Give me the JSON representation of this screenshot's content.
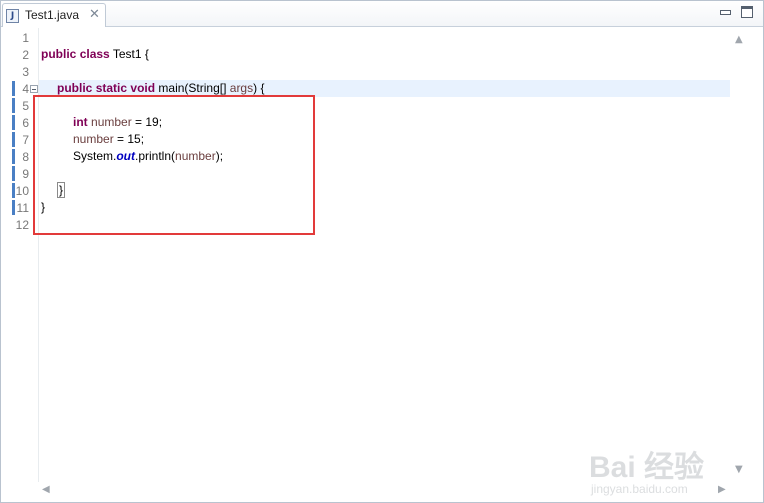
{
  "tab": {
    "label": "Test1.java",
    "icon": "java-file-icon",
    "close": "✕"
  },
  "window": {
    "minimize_icon": "minimize-icon",
    "maximize_icon": "maximize-icon"
  },
  "line_numbers": [
    "1",
    "2",
    "3",
    "4",
    "5",
    "6",
    "7",
    "8",
    "9",
    "10",
    "11",
    "12"
  ],
  "code": {
    "line2": {
      "kw1": "public",
      "kw2": "class",
      "text": " Test1 {"
    },
    "line4": {
      "kw1": "public",
      "kw2": "static",
      "kw3": "void",
      "pre": " main(String[] ",
      "var": "args",
      "post": ") {"
    },
    "line6": {
      "kw": "int",
      "var": "number",
      "post": " = 19;"
    },
    "line7": {
      "var": "number",
      "post": " = 15;"
    },
    "line8": {
      "pre": "System.",
      "field": "out",
      "mid": ".println(",
      "var": "number",
      "post": ");"
    },
    "line10": {
      "brace": "}"
    },
    "line11": {
      "brace": "}"
    }
  },
  "scroll": {
    "up": "▲",
    "down": "▼",
    "left": "◀",
    "right": "▶"
  },
  "watermark": {
    "logo": "Bai  经验",
    "url": "jingyan.baidu.com"
  },
  "colors": {
    "keyword": "#7f0055",
    "variable": "#6a3e3e",
    "static_field": "#0000c0",
    "highlight_box": "#e23a3a",
    "current_line": "#e8f2fe"
  }
}
